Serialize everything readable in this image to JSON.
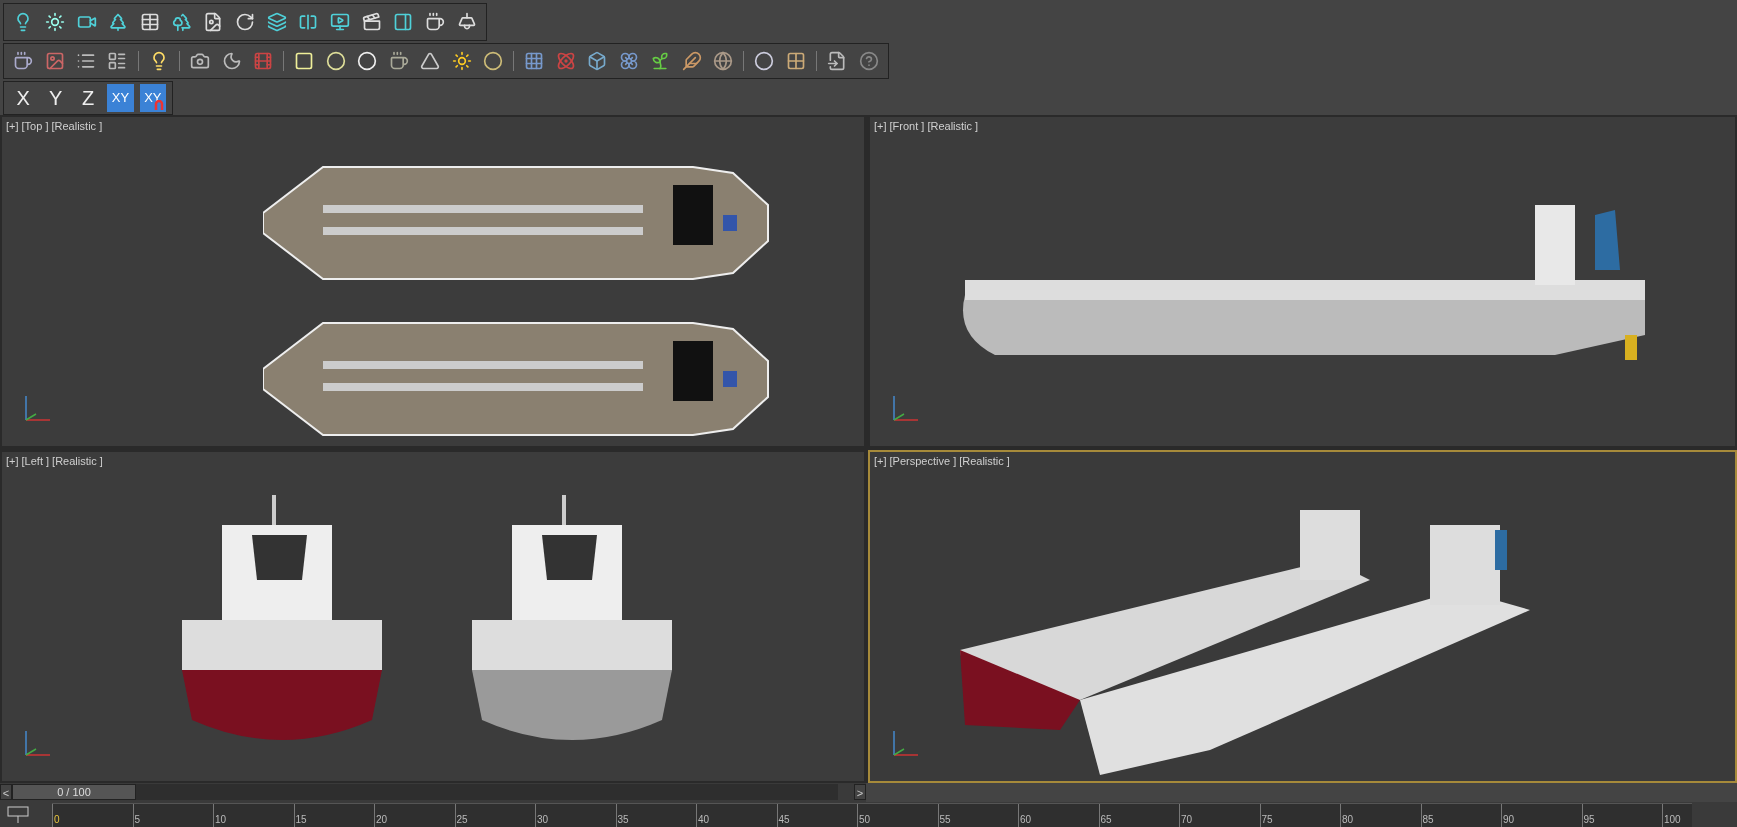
{
  "axis_toolbar": [
    {
      "label": "X",
      "selected": false
    },
    {
      "label": "Y",
      "selected": false
    },
    {
      "label": "Z",
      "selected": false
    },
    {
      "label": "XY",
      "selected": true,
      "kind": "plain"
    },
    {
      "label": "XY",
      "selected": true,
      "kind": "magnet"
    }
  ],
  "viewports": [
    {
      "menu": "[+]",
      "view": "[Top ]",
      "shading": "[Realistic ]",
      "selected": false,
      "kind": "top"
    },
    {
      "menu": "[+]",
      "view": "[Front ]",
      "shading": "[Realistic ]",
      "selected": false,
      "kind": "front"
    },
    {
      "menu": "[+]",
      "view": "[Left ]",
      "shading": "[Realistic ]",
      "selected": false,
      "kind": "left"
    },
    {
      "menu": "[+]",
      "view": "[Perspective ]",
      "shading": "[Realistic ]",
      "selected": true,
      "kind": "perspective"
    }
  ],
  "time_slider": {
    "prev": "<",
    "frame": "0 / 100",
    "next": ">",
    "level": 0
  },
  "timeline": {
    "ticks": [
      "0",
      "5",
      "10",
      "15",
      "20",
      "25",
      "30",
      "35",
      "40",
      "45",
      "50",
      "55",
      "60",
      "65",
      "70",
      "75",
      "80",
      "85",
      "90",
      "95",
      "100"
    ]
  }
}
